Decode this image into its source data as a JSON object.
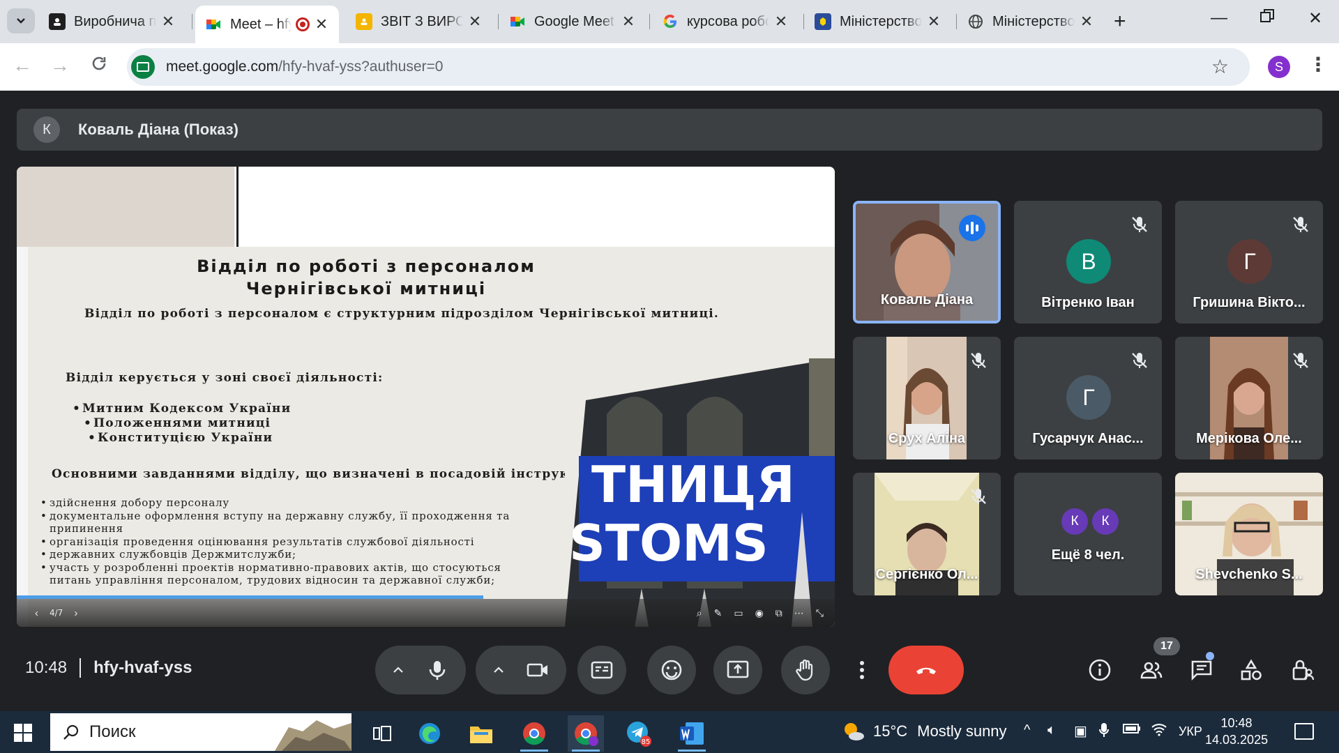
{
  "browser": {
    "tabs": [
      {
        "label": "Виробнича п",
        "icon": "meet-person-icon",
        "color": "#1f1f1f"
      },
      {
        "label": "Meet – hfy",
        "icon": "google-meet-icon",
        "recording": true
      },
      {
        "label": "ЗВІТ З ВИРОБ",
        "icon": "google-slides-icon"
      },
      {
        "label": "Google Meet",
        "icon": "google-meet-icon"
      },
      {
        "label": "курсова робо",
        "icon": "google-g-icon"
      },
      {
        "label": "Міністерство",
        "icon": "ministry-emblem-icon"
      },
      {
        "label": "Міністерство",
        "icon": "globe-icon"
      }
    ],
    "url_host": "meet.google.com",
    "url_path": "/hfy-hvaf-yss?authuser=0",
    "profile_initial": "S",
    "profile_color": "#8430ce"
  },
  "meet": {
    "presenter_initial": "К",
    "presenter_title": "Коваль Діана (Показ)",
    "slide": {
      "title_line1": "Відділ по роботі з персоналом",
      "title_line2": "Чернігівської митниці",
      "intro": "Відділ по роботі з персоналом є структурним підрозділом Чернігівської митниці.",
      "guided_heading": "Відділ керується у зоні своєї діяльності:",
      "guided_items": [
        "Митним Кодексом України",
        "Положеннями митниці",
        "Конституцією України"
      ],
      "tasks_heading": "Основними завданнями відділу, що визначені в посадовій інструкції є :",
      "tasks": [
        "здійснення добору персоналу",
        "документальне оформлення вступу на державну службу, її проходження та припинення",
        "організація проведення оцінювання результатів службової діяльності",
        "державних службовців Держмитслужби;",
        "участь у розробленні проектів нормативно-правових актів, що стосуються питань управління персоналом, трудових відносин та державної служби;"
      ],
      "photo_line1": "ТНИЦЯ",
      "photo_line2": "STOMS",
      "page_indicator": "4/7",
      "progress": 0.57
    },
    "participants": [
      {
        "name": "Коваль Діана",
        "type": "video",
        "speaking": true,
        "muted": false
      },
      {
        "name": "Вітренко Іван",
        "type": "avatar",
        "initial": "В",
        "color": "#0f8a76",
        "muted": true
      },
      {
        "name": "Гришина Вікто...",
        "type": "avatar",
        "initial": "Г",
        "color": "#5d3a36",
        "muted": true
      },
      {
        "name": "Єрух Аліна",
        "type": "video",
        "muted": true
      },
      {
        "name": "Гусарчук Анас...",
        "type": "avatar",
        "initial": "Г",
        "color": "#4a5a66",
        "muted": true
      },
      {
        "name": "Мерікова Оле...",
        "type": "video",
        "muted": true
      },
      {
        "name": "Сергієнко Ол...",
        "type": "video",
        "muted": true
      },
      {
        "name": "Ещё 8 чел.",
        "type": "more",
        "initials": [
          "К",
          "К"
        ]
      },
      {
        "name": "Shevchenko S...",
        "type": "video",
        "muted": false
      }
    ],
    "time": "10:48",
    "meeting_code": "hfy-hvaf-yss",
    "participant_count": "17",
    "end_call_color": "#ea4335"
  },
  "taskbar": {
    "search_placeholder": "Поиск",
    "telegram_badge": "85",
    "weather_temp": "15°C",
    "weather_desc": "Mostly sunny",
    "language": "УКР",
    "clock_time": "10:48",
    "clock_date": "14.03.2025"
  }
}
